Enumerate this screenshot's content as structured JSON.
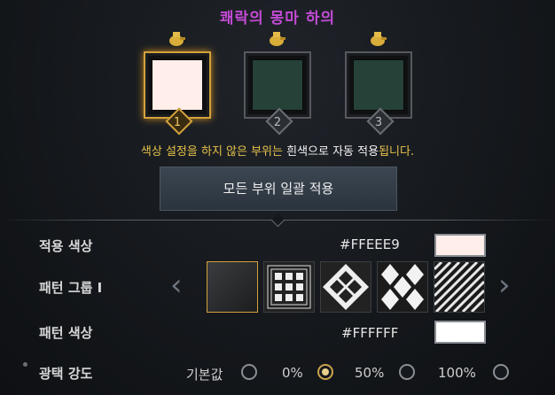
{
  "title": "쾌락의 몽마 하의",
  "slots": [
    {
      "number": "1",
      "color": "#FFEEE9",
      "selected": true
    },
    {
      "number": "2",
      "color": "#264238",
      "selected": false
    },
    {
      "number": "3",
      "color": "#264238",
      "selected": false
    }
  ],
  "notice": {
    "part1": "색상 설정을 하지 않은 부위는",
    "part2": " 흰색으로 자동 적용",
    "part3": "됩니다."
  },
  "apply_all_button": "모든 부위 일괄 적용",
  "applied_color": {
    "label": "적용 색상",
    "hex": "#FFEEE9"
  },
  "pattern_group": {
    "label": "패턴 그룹 I",
    "patterns": [
      "solid-dark",
      "grid-squares",
      "diamond-check",
      "argyle",
      "diagonal-weave"
    ],
    "selected": 0
  },
  "pattern_color": {
    "label": "패턴 색상",
    "hex": "#FFFFFF"
  },
  "gloss": {
    "label": "광택 강도",
    "options": [
      "기본값",
      "0%",
      "50%",
      "100%"
    ],
    "selected": 1
  },
  "colors": {
    "accent_gold": "#D3A23C",
    "title_purple": "#C34BD6",
    "notice_yellow": "#E7C24A"
  }
}
